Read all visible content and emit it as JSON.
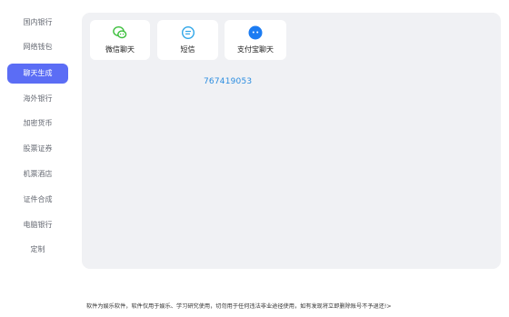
{
  "sidebar": {
    "items": [
      {
        "label": "国内银行"
      },
      {
        "label": "网络钱包"
      },
      {
        "label": "聊天生成"
      },
      {
        "label": "海外银行"
      },
      {
        "label": "加密货币"
      },
      {
        "label": "股票证券"
      },
      {
        "label": "机票酒店"
      },
      {
        "label": "证件合成"
      },
      {
        "label": "电脑银行"
      },
      {
        "label": "定制"
      }
    ],
    "active_index": 2
  },
  "cards": [
    {
      "label": "微信聊天",
      "icon": "wechat-icon",
      "color": "#3bbf3b"
    },
    {
      "label": "短信",
      "icon": "sms-icon",
      "color": "#2fa6e8"
    },
    {
      "label": "支付宝聊天",
      "icon": "alipay-chat-icon",
      "color": "#1c7cf2"
    }
  ],
  "code": "767419053",
  "footer": "软件为娱乐软件，软件仅用于娱乐、学习研究使用，切勿用于任何违法非业途径使用，如有发现将立即删除账号不予退还!>"
}
